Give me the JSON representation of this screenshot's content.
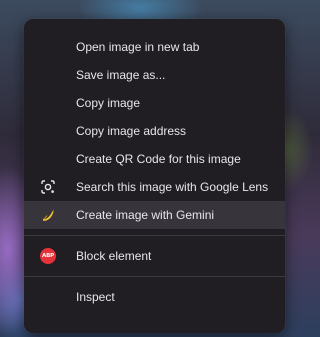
{
  "context_menu": {
    "items": [
      {
        "label": "Open image in new tab"
      },
      {
        "label": "Save image as..."
      },
      {
        "label": "Copy image"
      },
      {
        "label": "Copy image address"
      },
      {
        "label": "Create QR Code for this image"
      },
      {
        "label": "Search this image with Google Lens",
        "icon": "google-lens-icon"
      },
      {
        "label": "Create image with Gemini",
        "icon": "banana-icon",
        "highlighted": true
      }
    ],
    "extension_items": [
      {
        "label": "Block element",
        "icon": "adblock-plus-icon",
        "badge_text": "ABP"
      }
    ],
    "footer_items": [
      {
        "label": "Inspect"
      }
    ]
  },
  "colors": {
    "menu_background": "#211e23",
    "highlight_background": "#38343b",
    "text": "#e8e6ea",
    "abp_red": "#e5323a",
    "banana_yellow": "#f4c430"
  }
}
